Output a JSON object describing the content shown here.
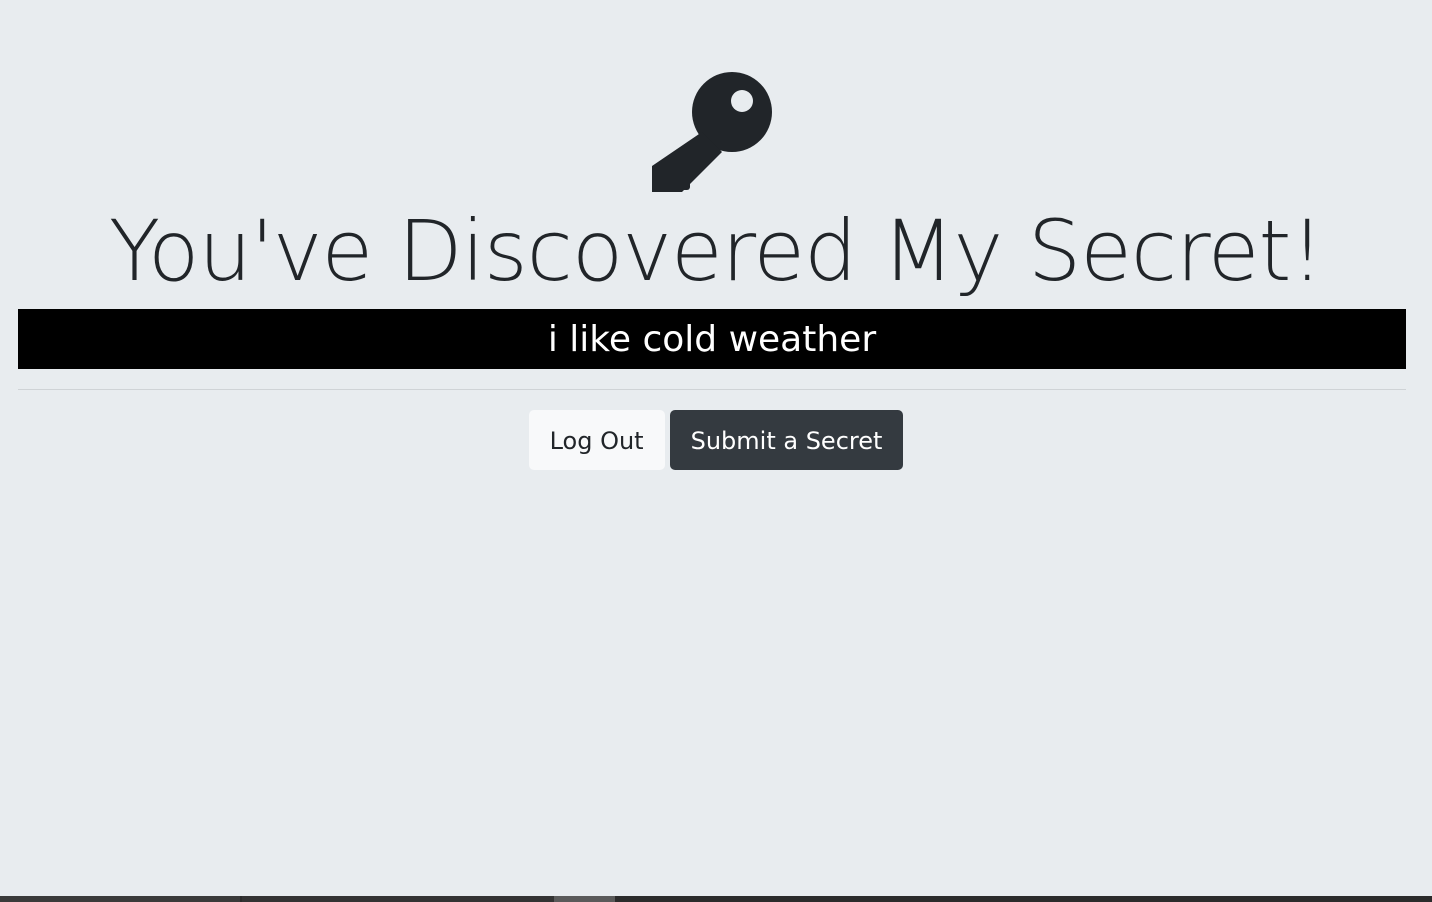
{
  "header": {
    "icon": "key-icon",
    "title": "You've Discovered My Secret!"
  },
  "secret": {
    "text": "i like cold weather"
  },
  "actions": {
    "logout_label": "Log Out",
    "submit_label": "Submit a Secret"
  },
  "colors": {
    "background": "#e8ecef",
    "secret_bar": "#000000",
    "secret_text": "#ffffff",
    "logout_button": "#f8f9fa",
    "submit_button": "#343a40",
    "icon": "#212529"
  }
}
